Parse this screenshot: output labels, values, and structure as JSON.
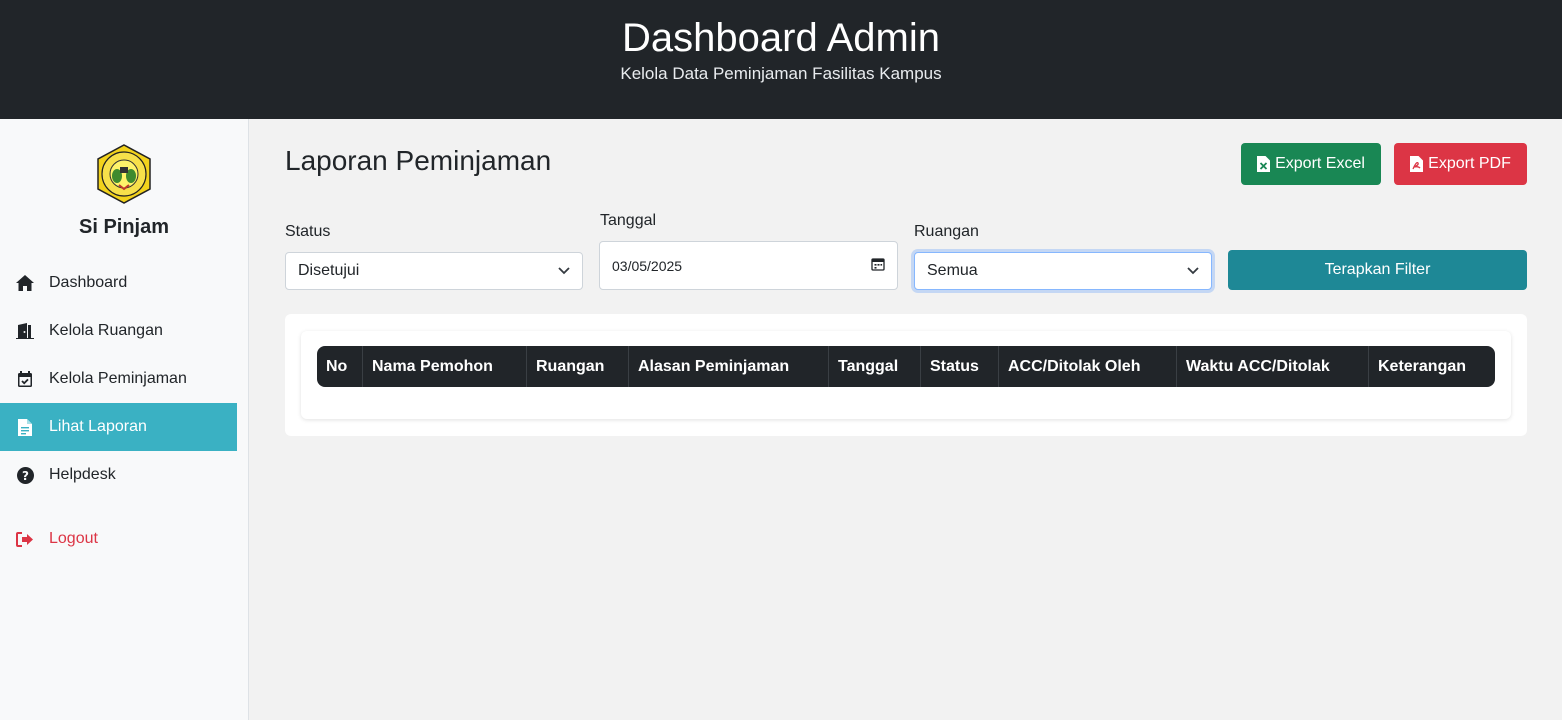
{
  "header": {
    "title": "Dashboard Admin",
    "subtitle": "Kelola Data Peminjaman Fasilitas Kampus"
  },
  "sidebar": {
    "brand": "Si Pinjam",
    "items": [
      {
        "label": "Dashboard",
        "icon": "home-icon"
      },
      {
        "label": "Kelola Ruangan",
        "icon": "door-icon"
      },
      {
        "label": "Kelola Peminjaman",
        "icon": "calendar-check-icon"
      },
      {
        "label": "Lihat Laporan",
        "icon": "file-icon",
        "active": true
      },
      {
        "label": "Helpdesk",
        "icon": "question-circle-icon"
      }
    ],
    "logout": "Logout"
  },
  "main": {
    "title": "Laporan Peminjaman",
    "export_excel": "Export Excel",
    "export_pdf": "Export PDF",
    "filters": {
      "status_label": "Status",
      "status_value": "Disetujui",
      "tanggal_label": "Tanggal",
      "tanggal_value": "03/05/2025",
      "ruangan_label": "Ruangan",
      "ruangan_value": "Semua",
      "apply": "Terapkan Filter"
    },
    "table": {
      "columns": [
        "No",
        "Nama Pemohon",
        "Ruangan",
        "Alasan Peminjaman",
        "Tanggal",
        "Status",
        "ACC/Ditolak Oleh",
        "Waktu ACC/Ditolak",
        "Keterangan"
      ]
    }
  },
  "colors": {
    "header_bg": "#212529",
    "active_nav": "#3ab1c3",
    "excel": "#198754",
    "pdf": "#dc3545",
    "filter": "#1e8896",
    "logout": "#dc3545"
  }
}
